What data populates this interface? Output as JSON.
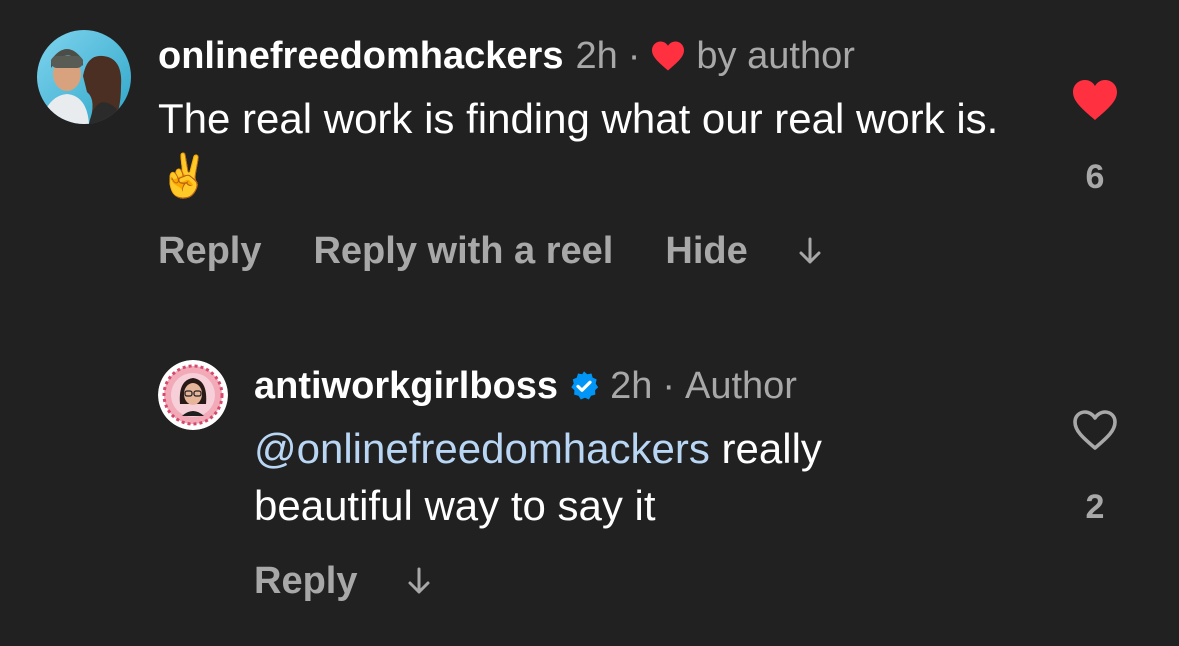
{
  "comment1": {
    "username": "onlinefreedomhackers",
    "time": "2h",
    "separator": "·",
    "liked_by": "by author",
    "text": "The real work is finding what our real work is.",
    "emoji": "✌️",
    "actions": {
      "reply": "Reply",
      "reply_reel": "Reply with a reel",
      "hide": "Hide"
    },
    "like_count": "6",
    "liked": true,
    "like_color": "#ff3040"
  },
  "comment2": {
    "username": "antiworkgirlboss",
    "verified": true,
    "verified_color": "#0095f6",
    "time": "2h",
    "separator": "·",
    "role": "Author",
    "mention": "@onlinefreedomhackers",
    "text_line1": " really",
    "text_line2": "beautiful way to say it",
    "actions": {
      "reply": "Reply"
    },
    "like_count": "2",
    "liked": false
  }
}
